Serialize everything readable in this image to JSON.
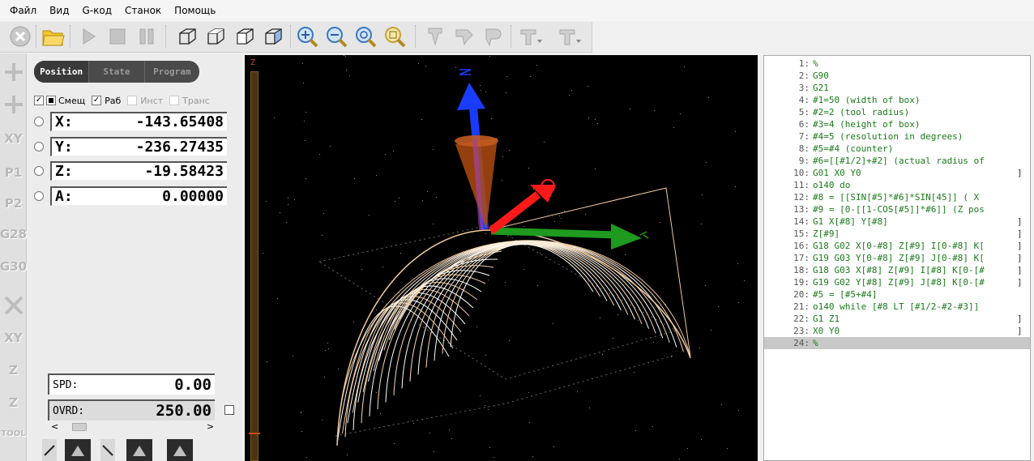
{
  "menu": [
    "Файл",
    "Вид",
    "G-код",
    "Станок",
    "Помощь"
  ],
  "toolbar": {
    "icons": [
      "stop-icon",
      "open-icon",
      "run-icon",
      "pause-icon",
      "step-icon",
      "view-iso-icon",
      "view-top-icon",
      "view-front-icon",
      "view-side-icon",
      "zoom-in-icon",
      "zoom-out-icon",
      "zoom-fit-icon",
      "zoom-window-icon",
      "tool-1-icon",
      "tool-2-icon",
      "tool-3-icon",
      "tool-4-icon",
      "tool-5-icon"
    ]
  },
  "sidestrip": {
    "labels": [
      "",
      "",
      "XY",
      "P1",
      "P2",
      "G28",
      "G30",
      "",
      "XY",
      "Z",
      "Z",
      "TOOL"
    ]
  },
  "tabs": [
    {
      "label": "Position",
      "active": true
    },
    {
      "label": "State",
      "active": false
    },
    {
      "label": "Program",
      "active": false
    }
  ],
  "checks": [
    {
      "label": "Смещ",
      "checked": true
    },
    {
      "label": "Раб",
      "checked": true
    },
    {
      "label": "Инст",
      "checked": false
    },
    {
      "label": "Транс",
      "checked": false
    }
  ],
  "dro": [
    {
      "axis": "X:",
      "value": "-143.65408"
    },
    {
      "axis": "Y:",
      "value": "-236.27435"
    },
    {
      "axis": "Z:",
      "value": "-19.58423"
    },
    {
      "axis": "A:",
      "value": "0.00000"
    }
  ],
  "spindle": {
    "label": "SPD:",
    "value": "0.00"
  },
  "override": {
    "label": "OVRD:",
    "value": "250.00"
  },
  "slider": {
    "left": "<",
    "right": ">"
  },
  "zscale": {
    "label": "Z"
  },
  "gcode": [
    {
      "n": "1:",
      "text": "%",
      "bracket": ""
    },
    {
      "n": "2:",
      "text": "G90",
      "bracket": ""
    },
    {
      "n": "3:",
      "text": "G21",
      "bracket": ""
    },
    {
      "n": "4:",
      "text": "#1=50 (width of box)",
      "bracket": ""
    },
    {
      "n": "5:",
      "text": "#2=2 (tool radius)",
      "bracket": ""
    },
    {
      "n": "6:",
      "text": "#3=4 (height of box)",
      "bracket": ""
    },
    {
      "n": "7:",
      "text": "#4=5 (resolution in degrees)",
      "bracket": ""
    },
    {
      "n": "8:",
      "text": "#5=#4 (counter)",
      "bracket": ""
    },
    {
      "n": "9:",
      "text": "#6=[[#1/2]+#2] (actual radius of",
      "bracket": ""
    },
    {
      "n": "10:",
      "text": "G01 X0 Y0",
      "bracket": "]"
    },
    {
      "n": "11:",
      "text": "o140 do",
      "bracket": ""
    },
    {
      "n": "12:",
      "text": "#8 = [[SIN[#5]*#6]*SIN[45]] ( X",
      "bracket": ""
    },
    {
      "n": "13:",
      "text": "#9 = [0-[[1-COS[#5]]*#6]] (Z pos",
      "bracket": ""
    },
    {
      "n": "14:",
      "text": "G1 X[#8] Y[#8]",
      "bracket": "]"
    },
    {
      "n": "15:",
      "text": "Z[#9]",
      "bracket": "]"
    },
    {
      "n": "16:",
      "text": "G18 G02 X[0-#8] Z[#9] I[0-#8] K[",
      "bracket": "]"
    },
    {
      "n": "17:",
      "text": "G19 G03 Y[0-#8] Z[#9] J[0-#8] K[",
      "bracket": "]"
    },
    {
      "n": "18:",
      "text": "G18 G03 X[#8] Z[#9] I[#8] K[0-[#",
      "bracket": "]"
    },
    {
      "n": "19:",
      "text": "G19 G02 Y[#8] Z[#9] J[#8] K[0-[#",
      "bracket": "]"
    },
    {
      "n": "20:",
      "text": "#5 = [#5+#4]",
      "bracket": ""
    },
    {
      "n": "21:",
      "text": "o140 while [#8 LT [#1/2-#2-#3]]",
      "bracket": ""
    },
    {
      "n": "22:",
      "text": "G1 Z1",
      "bracket": "]"
    },
    {
      "n": "23:",
      "text": "X0 Y0",
      "bracket": "]"
    },
    {
      "n": "24:",
      "text": "%",
      "bracket": ""
    }
  ],
  "colors": {
    "toolpath": "#f0c89a",
    "axis_x": "#ff1a1a",
    "axis_y": "#1e9a1e",
    "axis_z": "#1a3cff",
    "tool": "#b04a10",
    "gcode_text": "#1a7a1a",
    "selected_line": "#c8c8c8"
  }
}
